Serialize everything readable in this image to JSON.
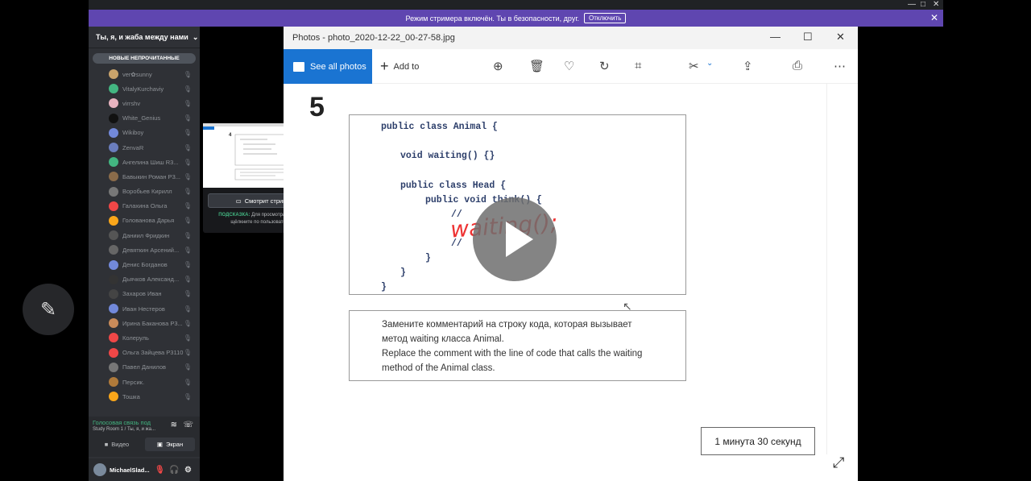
{
  "streamer_banner": {
    "text": "Режим стримера включён. Ты в безопасности, друг.",
    "button": "Отключить"
  },
  "server": {
    "name": "Ты, я, и жаба между нами"
  },
  "new_unread": "НОВЫЕ НЕПРОЧИТАННЫЕ",
  "members": [
    {
      "name": "ver✿sunny",
      "color": "#c9a36b"
    },
    {
      "name": "VitalyKurchaviy",
      "color": "#43b581"
    },
    {
      "name": "virrshv",
      "color": "#e8b4c0"
    },
    {
      "name": "White_Genius",
      "color": "#111111"
    },
    {
      "name": "Wikiboy",
      "color": "#7289da"
    },
    {
      "name": "ZenvaR",
      "color": "#6a7dbd"
    },
    {
      "name": "Ангелина Шиш R3...",
      "color": "#43b581"
    },
    {
      "name": "Бавыкин Роман Р3...",
      "color": "#8a6b4a"
    },
    {
      "name": "Воробьев Кирилл",
      "color": "#777777"
    },
    {
      "name": "Галахина Ольга",
      "color": "#f04747"
    },
    {
      "name": "Голованова Дарья",
      "color": "#faa61a"
    },
    {
      "name": "Даниил Фридкин",
      "color": "#555555"
    },
    {
      "name": "Девяткин Арсений...",
      "color": "#666666"
    },
    {
      "name": "Денис Богданов",
      "color": "#7289da"
    },
    {
      "name": "Дьячков Александ...",
      "color": "#333333"
    },
    {
      "name": "Захаров Иван",
      "color": "#444444"
    },
    {
      "name": "Иван Нестеров",
      "color": "#7289da"
    },
    {
      "name": "Ирина Баканова Р3...",
      "color": "#c98b5a"
    },
    {
      "name": "Колеруль",
      "color": "#f04747"
    },
    {
      "name": "Ольга Зайцева Р3110",
      "color": "#f04747"
    },
    {
      "name": "Павел Данилов",
      "color": "#777777"
    },
    {
      "name": "Персик.",
      "color": "#b07a3a"
    },
    {
      "name": "Тошка",
      "color": "#faa61a"
    }
  ],
  "voice": {
    "status": "Голосовая связь под",
    "room": "Study Room 1 / Ты, я, и жа...",
    "video_label": "Видео",
    "screen_label": "Экран"
  },
  "user": {
    "name": "MichaelSlad..."
  },
  "popup": {
    "watch_label": "Смотрит стрим",
    "hint_prefix": "ПОДСКАЗКА:",
    "hint_text": "Для просмотра дважды щёлкните по пользователю"
  },
  "photos": {
    "title": "Photos - photo_2020-12-22_00-27-58.jpg",
    "see_all": "See all photos",
    "add_to": "Add to"
  },
  "document": {
    "task_number": "5",
    "code_lines": [
      "public class Animal {",
      "void waiting() {}",
      "public class Head {",
      "public void think() {",
      "//",
      "//",
      "}",
      "}",
      "}"
    ],
    "handwritten": "waiting();",
    "task_ru_1": "Замените комментарий на строку кода, которая вызывает",
    "task_ru_2": "метод waiting класса Animal.",
    "task_en_1": "Replace the comment with the line of code that calls the waiting",
    "task_en_2": "method of the Animal class.",
    "timer": "1 минута 30 секунд"
  }
}
